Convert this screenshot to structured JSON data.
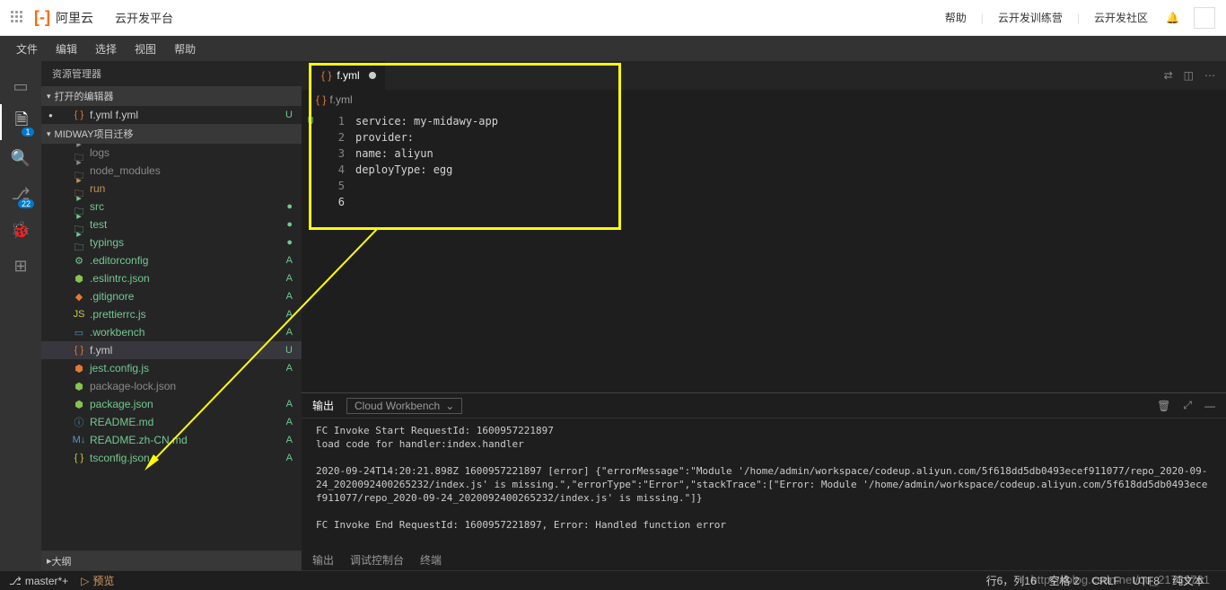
{
  "header": {
    "logo_symbol": "[-]",
    "logo_text": "阿里云",
    "platform": "云开发平台",
    "links": [
      "帮助",
      "云开发训练营",
      "云开发社区"
    ]
  },
  "menu": [
    "文件",
    "编辑",
    "选择",
    "视图",
    "帮助"
  ],
  "activity": {
    "badge1": "1",
    "badge2": "22"
  },
  "sidebar": {
    "title": "资源管理器",
    "open_editors": "打开的编辑器",
    "open_file": "f.yml f.yml",
    "open_status": "U",
    "project": "MIDWAY项目迁移",
    "outline": "大纲",
    "tree": [
      {
        "name": "logs",
        "type": "folder",
        "cls": "folder-icon txt-dim"
      },
      {
        "name": "node_modules",
        "type": "folder",
        "cls": "folder-icon txt-dim"
      },
      {
        "name": "run",
        "type": "folder",
        "cls": "folder-icon"
      },
      {
        "name": "src",
        "type": "folder",
        "cls": "green-fold txt-green",
        "status": "●"
      },
      {
        "name": "test",
        "type": "folder",
        "cls": "green-fold txt-green",
        "status": "●"
      },
      {
        "name": "typings",
        "type": "folder",
        "cls": "green-fold txt-green",
        "status": "●"
      },
      {
        "name": ".editorconfig",
        "type": "file",
        "cls": "txt-green",
        "icon": "⚙",
        "status": "A"
      },
      {
        "name": ".eslintrc.json",
        "type": "file",
        "cls": "txt-green",
        "icon": "⬢",
        "iconcls": "json-icon",
        "status": "A"
      },
      {
        "name": ".gitignore",
        "type": "file",
        "cls": "txt-green",
        "icon": "◆",
        "iconcls": "git-icon",
        "status": "A"
      },
      {
        "name": ".prettierrc.js",
        "type": "file",
        "cls": "txt-green",
        "icon": "JS",
        "iconcls": "js-icon",
        "status": "A"
      },
      {
        "name": ".workbench",
        "type": "file",
        "cls": "txt-green",
        "icon": "▭",
        "iconcls": "md-icon",
        "status": "A"
      },
      {
        "name": "f.yml",
        "type": "file",
        "cls": "",
        "icon": "{ }",
        "iconcls": "yml-icon",
        "status": "U",
        "sel": true
      },
      {
        "name": "jest.config.js",
        "type": "file",
        "cls": "txt-green",
        "icon": "⬢",
        "iconcls": "git-icon",
        "status": "A"
      },
      {
        "name": "package-lock.json",
        "type": "file",
        "cls": "txt-dim",
        "icon": "⬢",
        "iconcls": "json-icon"
      },
      {
        "name": "package.json",
        "type": "file",
        "cls": "txt-green",
        "icon": "⬢",
        "iconcls": "json-icon",
        "status": "A"
      },
      {
        "name": "README.md",
        "type": "file",
        "cls": "txt-green",
        "icon": "ⓘ",
        "iconcls": "md-icon",
        "status": "A"
      },
      {
        "name": "README.zh-CN.md",
        "type": "file",
        "cls": "txt-green",
        "icon": "M↓",
        "iconcls": "md-icon",
        "status": "A"
      },
      {
        "name": "tsconfig.json",
        "type": "file",
        "cls": "txt-green",
        "icon": "{ }",
        "iconcls": "js-icon",
        "status": "A"
      }
    ]
  },
  "editor": {
    "tab_name": "f.yml",
    "breadcrumb": "f.yml",
    "gutter_marker": "U",
    "code": [
      "service: my-midawy-app",
      "",
      "provider:",
      "  name: aliyun",
      "",
      "deployType: egg"
    ]
  },
  "panel": {
    "tab_output": "输出",
    "dropdown": "Cloud Workbench",
    "lines": [
      "FC Invoke Start RequestId: 1600957221897",
      "load code for handler:index.handler",
      "",
      "2020-09-24T14:20:21.898Z 1600957221897 [error] {\"errorMessage\":\"Module '/home/admin/workspace/codeup.aliyun.com/5f618dd5db0493ecef911077/repo_2020-09-24_2020092400265232/index.js' is missing.\",\"errorType\":\"Error\",\"stackTrace\":[\"Error: Module '/home/admin/workspace/codeup.aliyun.com/5f618dd5db0493ecef911077/repo_2020-09-24_2020092400265232/index.js' is missing.\"]}",
      "",
      "FC Invoke End RequestId: 1600957221897, Error: Handled function error"
    ],
    "bottom_tabs": [
      "输出",
      "调试控制台",
      "终端"
    ]
  },
  "status": {
    "branch": "master*+",
    "preview": "预览",
    "pos": "行6，列16",
    "spaces": "空格 2",
    "crlf": "CRLF",
    "enc": "UTF8",
    "mode": "纯文本"
  },
  "watermark": "https://blog.csdn.net/qq_21739761"
}
